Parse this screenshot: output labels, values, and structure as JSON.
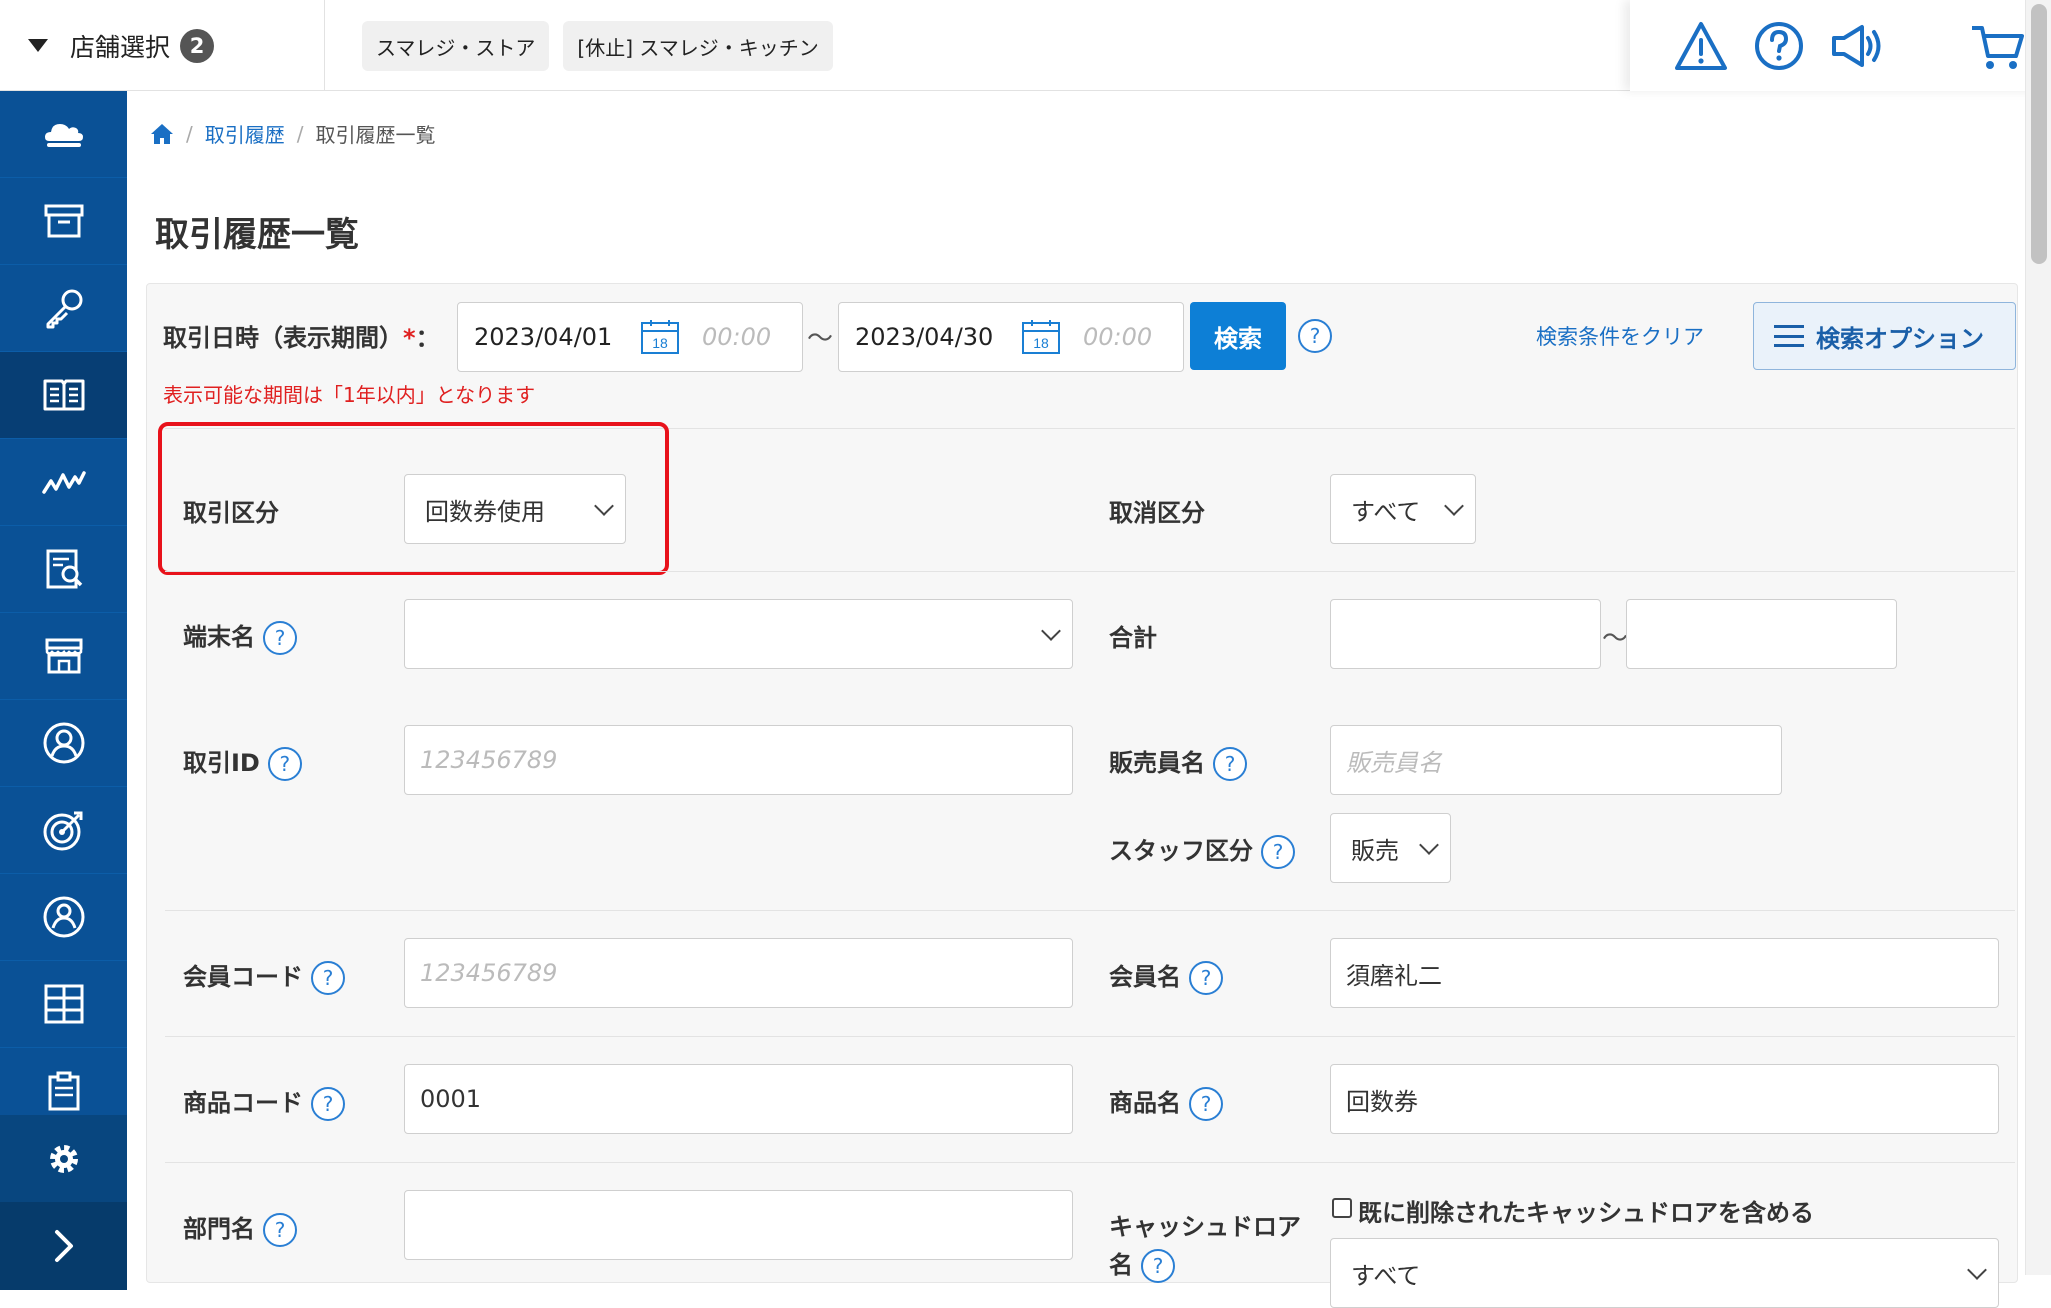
{
  "topbar": {
    "store_select_label": "店舗選択",
    "store_count": "2",
    "store_tabs": [
      "スマレジ・ストア",
      "[休止] スマレジ・キッチン"
    ],
    "icons": [
      "warning-icon",
      "help-icon",
      "megaphone-icon",
      "cart-icon"
    ]
  },
  "sidebar": {
    "items": [
      "cloud-icon",
      "archive-box-icon",
      "key-icon",
      "book-icon",
      "chart-line-icon",
      "report-search-icon",
      "store-icon",
      "user-circle-icon",
      "target-icon",
      "member-icon",
      "grid-icon",
      "clipboard-icon"
    ],
    "active_index": 3,
    "bottom": [
      "gear-icon",
      "chevron-right-icon"
    ]
  },
  "breadcrumb": {
    "separator": "/",
    "level1": "取引履歴",
    "current": "取引履歴一覧"
  },
  "page_title": "取引履歴一覧",
  "search": {
    "date_label": "取引日時（表示期間）",
    "required_mark": "*",
    "colon": "：",
    "date_from": "2023/04/01",
    "time_from_placeholder": "00:00",
    "calendar_day": "18",
    "tilde": "〜",
    "date_to": "2023/04/30",
    "time_to_placeholder": "00:00",
    "search_button": "検索",
    "help": "?",
    "clear_link": "検索条件をクリア",
    "options_button": "検索オプション",
    "warning": "表示可能な期間は「1年以内」となります"
  },
  "form": {
    "transaction_type_label": "取引区分",
    "transaction_type_value": "回数券使用",
    "cancel_type_label": "取消区分",
    "cancel_type_value": "すべて",
    "terminal_label": "端末名",
    "terminal_value": "",
    "total_label": "合計",
    "total_from": "",
    "total_to": "",
    "transaction_id_label": "取引ID",
    "transaction_id_placeholder": "123456789",
    "staff_name_label": "販売員名",
    "staff_name_placeholder": "販売員名",
    "staff_type_label": "スタッフ区分",
    "staff_type_value": "販売",
    "member_code_label": "会員コード",
    "member_code_placeholder": "123456789",
    "member_name_label": "会員名",
    "member_name_value": "須磨礼二",
    "product_code_label": "商品コード",
    "product_code_value": "0001",
    "product_name_label": "商品名",
    "product_name_value": "回数券",
    "department_label": "部門名",
    "department_value": "",
    "cash_drawer_label_1": "キャッシュドロア",
    "cash_drawer_label_2": "名",
    "include_deleted_label": "既に削除されたキャッシュドロアを含める",
    "cash_drawer_value": "すべて"
  },
  "colors": {
    "sidebar": "#0a5196",
    "primary_button": "#0d7fd6",
    "link": "#1a6fc4",
    "error": "#e02020",
    "highlight_border": "#e8121b"
  }
}
